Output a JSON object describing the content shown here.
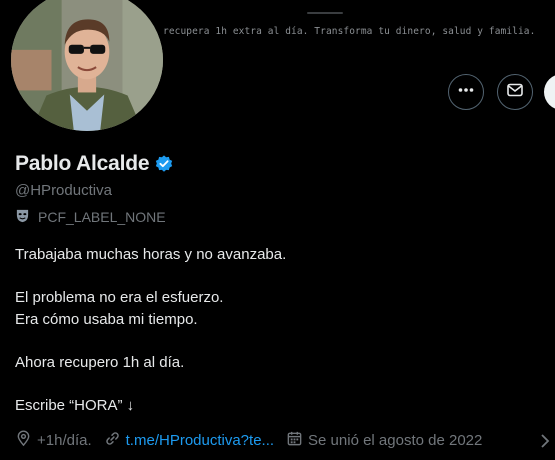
{
  "banner": {
    "text": "recupera 1h extra al día. Transforma tu dinero, salud y familia."
  },
  "profile": {
    "name": "Pablo Alcalde",
    "handle": "@HProductiva",
    "label": "PCF_LABEL_NONE",
    "verified": true,
    "accent_color": "#1d9bf0"
  },
  "bio": {
    "lines": [
      "Trabajaba muchas horas y no avanzaba.",
      "",
      "El problema no era el esfuerzo.",
      "Era cómo usaba mi tiempo.",
      "",
      "Ahora recupero 1h al día.",
      "",
      "Escribe “HORA” ↓"
    ]
  },
  "meta": {
    "location": "+1h/día.",
    "link": "t.me/HProductiva?te...",
    "joined": "Se unió el agosto de 2022"
  },
  "icons": {
    "more": "more-icon",
    "message": "mail-icon",
    "verified": "verified-badge-icon",
    "label": "mask-icon",
    "location": "location-pin-icon",
    "link": "link-icon",
    "calendar": "calendar-icon",
    "chevron": "chevron-right-icon"
  }
}
